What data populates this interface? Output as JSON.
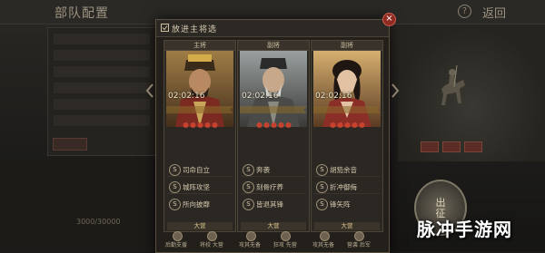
{
  "background": {
    "title": "部队配置",
    "help": "?",
    "back": "返回",
    "counter": "3000/30000",
    "badge_line1": "出",
    "badge_line2": "征"
  },
  "modal": {
    "title": "放进主将选",
    "close": "×"
  },
  "cards": [
    {
      "role": "主将",
      "timer": "02:02:16",
      "stars": 5,
      "skills": [
        "司命自立",
        "城阵攻坚",
        "所向披靡"
      ],
      "category": "大营",
      "bottom": [
        "后勤支援",
        "将校 大营"
      ]
    },
    {
      "role": "副将",
      "timer": "02:02:16",
      "stars": 5,
      "skills": [
        "奔袭",
        "刻骨疗养",
        "皆退其锋"
      ],
      "category": "大营",
      "bottom": [
        "攻其无备",
        "狂攻 先营"
      ]
    },
    {
      "role": "副将",
      "timer": "02:02:16",
      "stars": 5,
      "skills": [
        "胡笳余音",
        "折冲御侮",
        "锋矢阵"
      ],
      "category": "大营",
      "bottom": [
        "攻其无备",
        "营袭 后军"
      ]
    }
  ],
  "watermark": "脉冲手游网",
  "colors": {
    "star": "#c8432f",
    "close": "#8e2a22",
    "ribbon": "#8a6a2a"
  }
}
